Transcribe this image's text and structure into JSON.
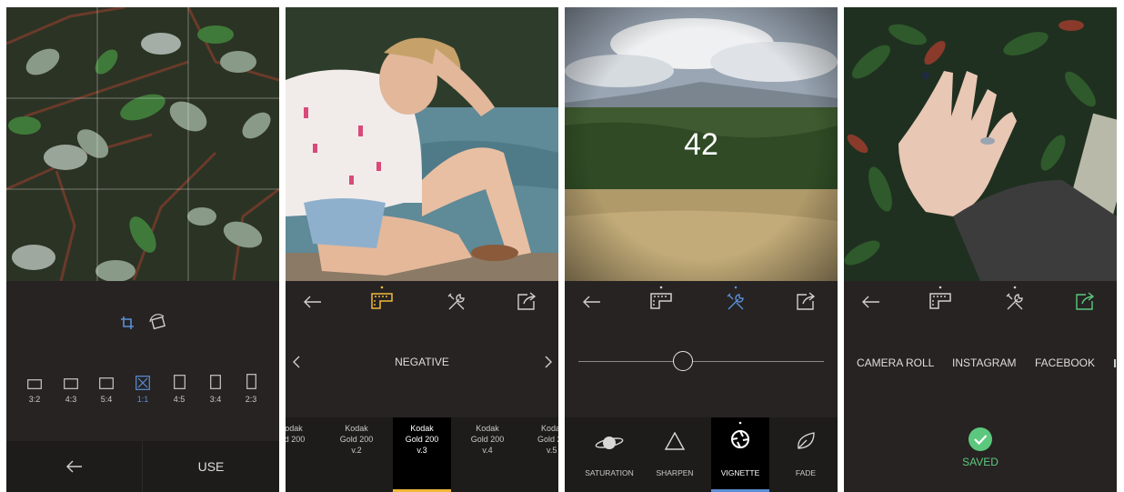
{
  "colors": {
    "panel_bg": "#262322",
    "dark_bar": "#1e1c1b",
    "accent_blue": "#5a8fd8",
    "accent_yellow": "#f0b93a",
    "accent_green": "#5cc87e",
    "text": "#dedede"
  },
  "crop_screen": {
    "tools": [
      "crop-icon",
      "rotate-icon"
    ],
    "ratios": [
      {
        "label": "3:2",
        "selected": false
      },
      {
        "label": "4:3",
        "selected": false
      },
      {
        "label": "5:4",
        "selected": false
      },
      {
        "label": "1:1",
        "selected": true
      },
      {
        "label": "4:5",
        "selected": false
      },
      {
        "label": "3:4",
        "selected": false
      },
      {
        "label": "2:3",
        "selected": false
      }
    ],
    "back_icon": "arrow-left-icon",
    "use_label": "USE"
  },
  "film_screen": {
    "toolbar": [
      "arrow-left-icon",
      "film-icon",
      "tools-icon",
      "share-icon"
    ],
    "active_tool": "film-icon",
    "category": "NEGATIVE",
    "films": [
      {
        "line1": "odak",
        "line2": "ld 200",
        "line3": "",
        "selected": false
      },
      {
        "line1": "Kodak",
        "line2": "Gold 200",
        "line3": "v.2",
        "selected": false
      },
      {
        "line1": "Kodak",
        "line2": "Gold 200",
        "line3": "v.3",
        "selected": true
      },
      {
        "line1": "Kodak",
        "line2": "Gold 200",
        "line3": "v.4",
        "selected": false
      },
      {
        "line1": "Koda",
        "line2": "Gold 2",
        "line3": "v.5",
        "selected": false
      }
    ]
  },
  "adjust_screen": {
    "toolbar": [
      "arrow-left-icon",
      "film-icon",
      "tools-icon",
      "share-icon"
    ],
    "active_tool": "tools-icon",
    "value": "42",
    "slider_fraction": 0.42,
    "tools": [
      {
        "label": "SATURATION",
        "icon": "planet-icon",
        "selected": false
      },
      {
        "label": "SHARPEN",
        "icon": "triangle-icon",
        "selected": false
      },
      {
        "label": "VIGNETTE",
        "icon": "aperture-icon",
        "selected": true
      },
      {
        "label": "FADE",
        "icon": "leaf-icon",
        "selected": false
      }
    ]
  },
  "share_screen": {
    "toolbar": [
      "arrow-left-icon",
      "film-icon",
      "tools-icon",
      "share-icon"
    ],
    "active_tool": "share-icon",
    "targets": [
      "CAMERA ROLL",
      "INSTAGRAM",
      "FACEBOOK"
    ],
    "saved_label": "SAVED"
  }
}
